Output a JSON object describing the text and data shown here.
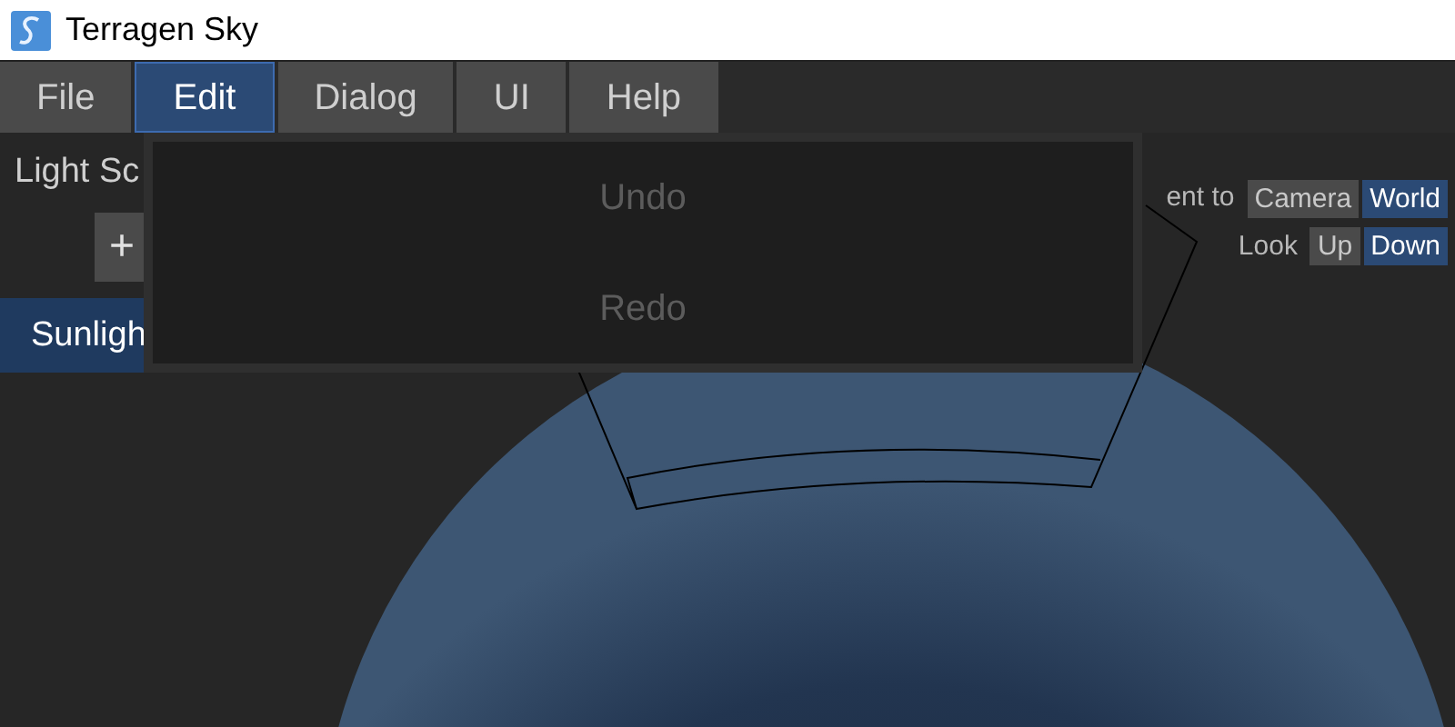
{
  "window": {
    "title": "Terragen Sky"
  },
  "menu": [
    {
      "label": "File",
      "selected": false
    },
    {
      "label": "Edit",
      "selected": true
    },
    {
      "label": "Dialog",
      "selected": false
    },
    {
      "label": "UI",
      "selected": false
    },
    {
      "label": "Help",
      "selected": false
    }
  ],
  "sidebar": {
    "heading": "Light Sc",
    "add_button": "+",
    "items": [
      {
        "label": "Sunligh",
        "selected": true
      }
    ]
  },
  "orient": {
    "label": "ent to",
    "options": [
      {
        "label": "Camera",
        "selected": false
      },
      {
        "label": "World",
        "selected": true
      }
    ]
  },
  "look": {
    "label": "Look",
    "options": [
      {
        "label": "Up",
        "selected": false
      },
      {
        "label": "Down",
        "selected": true
      }
    ]
  },
  "dropdown": {
    "items": [
      {
        "label": "Undo",
        "disabled": true
      },
      {
        "label": "Redo",
        "disabled": true
      }
    ]
  }
}
